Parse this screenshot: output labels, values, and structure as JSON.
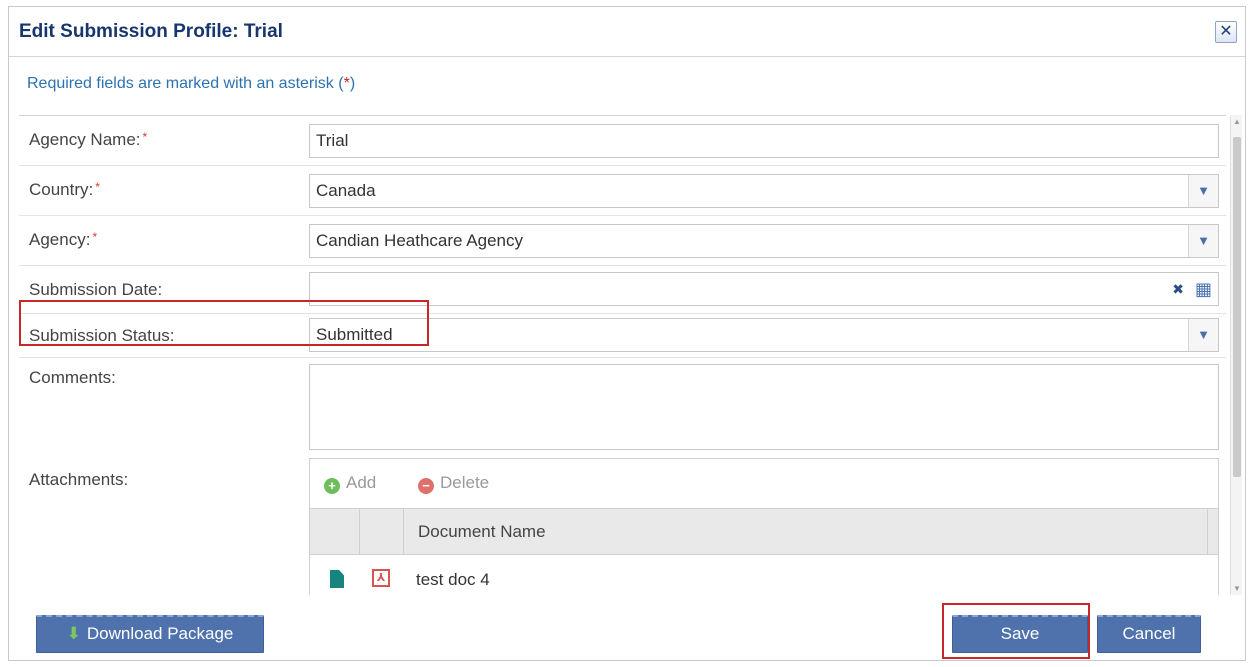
{
  "dialog": {
    "title": "Edit Submission Profile: Trial",
    "close_symbol": "✕"
  },
  "note": {
    "prefix": "Required fields are marked with an asterisk (",
    "star": "*",
    "suffix": ")"
  },
  "form": {
    "agency_name": {
      "label": "Agency Name:",
      "required": "*",
      "value": "Trial"
    },
    "country": {
      "label": "Country:",
      "required": "*",
      "value": "Canada"
    },
    "agency": {
      "label": "Agency:",
      "required": "*",
      "value": "Candian Heathcare Agency"
    },
    "submission_date": {
      "label": "Submission Date:",
      "value": "",
      "clear_symbol": "✖",
      "calendar_symbol": "▦"
    },
    "submission_status": {
      "label": "Submission Status:",
      "value": "Submitted"
    },
    "comments": {
      "label": "Comments:",
      "value": ""
    },
    "attachments": {
      "label": "Attachments:",
      "add_label": "Add",
      "delete_label": "Delete",
      "column_header": "Document Name",
      "rows": [
        {
          "name": "test doc 4"
        }
      ]
    }
  },
  "icons": {
    "dropdown": "chevron-down-icon",
    "add": "plus-circle-icon",
    "delete": "minus-circle-icon",
    "doc": "document-icon",
    "pdf": "pdf-icon"
  },
  "footer": {
    "download_label": "Download Package",
    "save_label": "Save",
    "cancel_label": "Cancel"
  },
  "colors": {
    "title": "#17366e",
    "note": "#2d72b0",
    "button": "#4f72ad",
    "highlight": "#c62828"
  }
}
